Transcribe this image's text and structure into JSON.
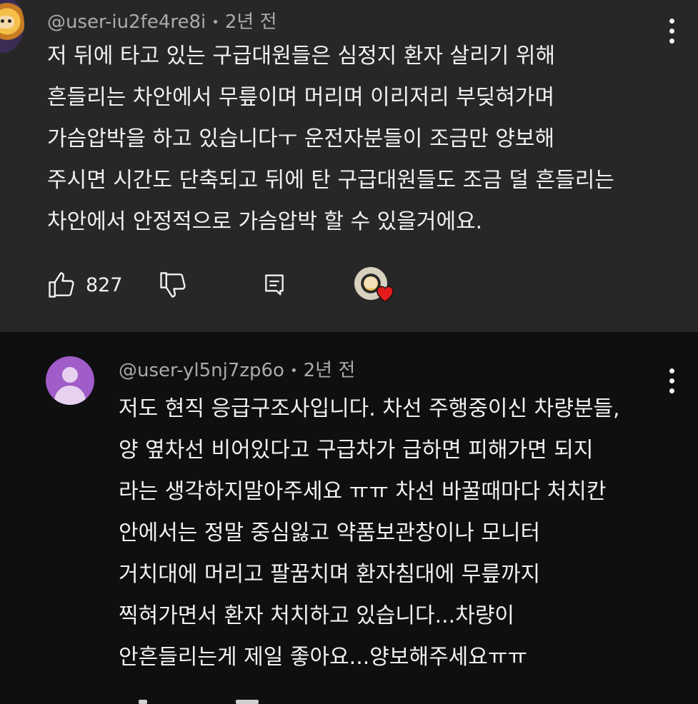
{
  "top_comment": {
    "handle": "@user-iu2fe4re8i",
    "separator": "•",
    "time": "2년 전",
    "lines": [
      "저 뒤에 타고 있는 구급대원들은 심정지 환자 살리기 위해",
      "흔들리는 차안에서 무릎이며 머리며 이리저리 부딪혀가며",
      "가슴압박을 하고 있습니다ㅜ 운전자분들이 조금만 양보해",
      "주시면 시간도 단축되고 뒤에 탄 구급대원들도 조금 덜 흔들리는",
      "차안에서 안정적으로 가슴압박 할 수 있을거에요."
    ],
    "like_count": "827",
    "icons": {
      "like": "thumbs-up-icon",
      "dislike": "thumbs-down-icon",
      "reply": "reply-icon",
      "more": "more-vert-icon",
      "creator_heart": "heart-icon"
    }
  },
  "reply": {
    "handle": "@user-yl5nj7zp6o",
    "separator": "•",
    "time": "2년 전",
    "lines": [
      "저도 현직 응급구조사입니다. 차선 주행중이신 차량분들,",
      "양 옆차선 비어있다고 구급차가 급하면 피해가면 되지",
      "라는 생각하지말아주세요 ㅠㅠ 차선 바꿀때마다 처치칸",
      "안에서는 정말 중심잃고 약품보관창이나 모니터",
      "거치대에 머리고 팔꿈치며 환자침대에 무릎까지",
      "찍혀가면서 환자 처치하고 있습니다...차량이",
      "안흔들리는게 제일 좋아요...양보해주세요ㅠㅠ"
    ]
  },
  "colors": {
    "top_background": "#272727",
    "page_background": "#0f0f0f",
    "text": "#f1f1f1",
    "meta": "#aaaaaa",
    "reply_avatar": "#a05cc8",
    "heart": "#e21b1b"
  }
}
